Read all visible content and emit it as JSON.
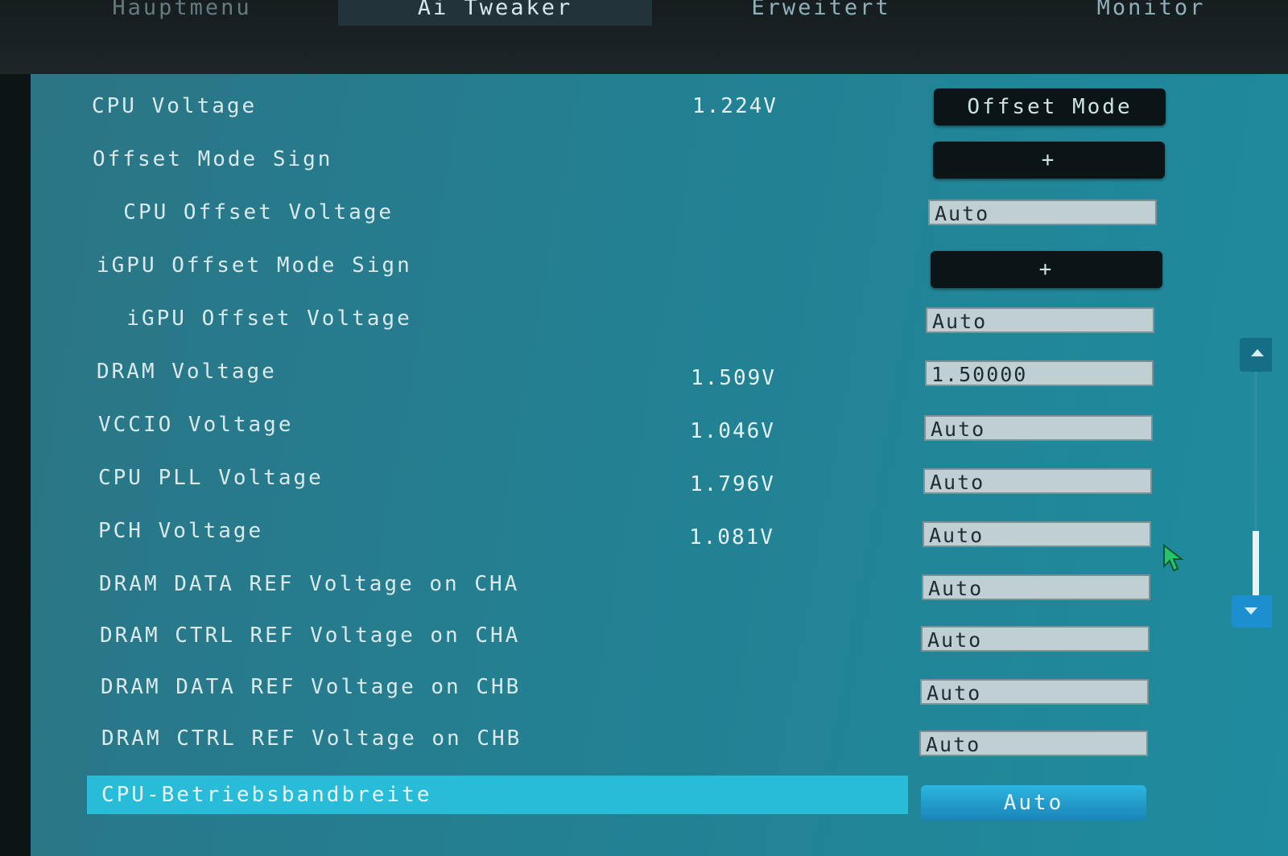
{
  "tabs": [
    {
      "label": "Hauptmenü"
    },
    {
      "label": "Ai Tweaker",
      "active": true
    },
    {
      "label": "Erweitert"
    },
    {
      "label": "Monitor"
    }
  ],
  "settings": [
    {
      "label": "CPU Voltage",
      "current": "1.224V",
      "value": "Offset Mode",
      "control": "button"
    },
    {
      "label": "Offset Mode Sign",
      "current": "",
      "value": "+",
      "control": "button"
    },
    {
      "label": "  CPU Offset Voltage",
      "current": "",
      "value": "Auto",
      "control": "field"
    },
    {
      "label": "iGPU Offset Mode Sign",
      "current": "",
      "value": "+",
      "control": "button"
    },
    {
      "label": "  iGPU Offset Voltage",
      "current": "",
      "value": "Auto",
      "control": "field"
    },
    {
      "label": "DRAM Voltage",
      "current": "1.509V",
      "value": "1.50000",
      "control": "field"
    },
    {
      "label": "VCCIO Voltage",
      "current": "1.046V",
      "value": "Auto",
      "control": "field"
    },
    {
      "label": "CPU PLL Voltage",
      "current": "1.796V",
      "value": "Auto",
      "control": "field"
    },
    {
      "label": "PCH Voltage",
      "current": "1.081V",
      "value": "Auto",
      "control": "field"
    },
    {
      "label": "DRAM DATA REF Voltage on CHA",
      "current": "",
      "value": "Auto",
      "control": "field"
    },
    {
      "label": "DRAM CTRL REF Voltage on CHA",
      "current": "",
      "value": "Auto",
      "control": "field"
    },
    {
      "label": "DRAM DATA REF Voltage on CHB",
      "current": "",
      "value": "Auto",
      "control": "field"
    },
    {
      "label": "DRAM CTRL REF Voltage on CHB",
      "current": "",
      "value": "Auto",
      "control": "field"
    }
  ],
  "selected": {
    "label": "CPU-Betriebsbandbreite",
    "value": "Auto"
  },
  "colors": {
    "panel": "#238092",
    "highlight": "#29bcd9",
    "field": "#c0cfd2",
    "button": "#0b1417"
  },
  "icons": {
    "scroll_up": "triangle-up-icon",
    "scroll_down": "triangle-down-icon",
    "cursor": "mouse-pointer-icon"
  }
}
